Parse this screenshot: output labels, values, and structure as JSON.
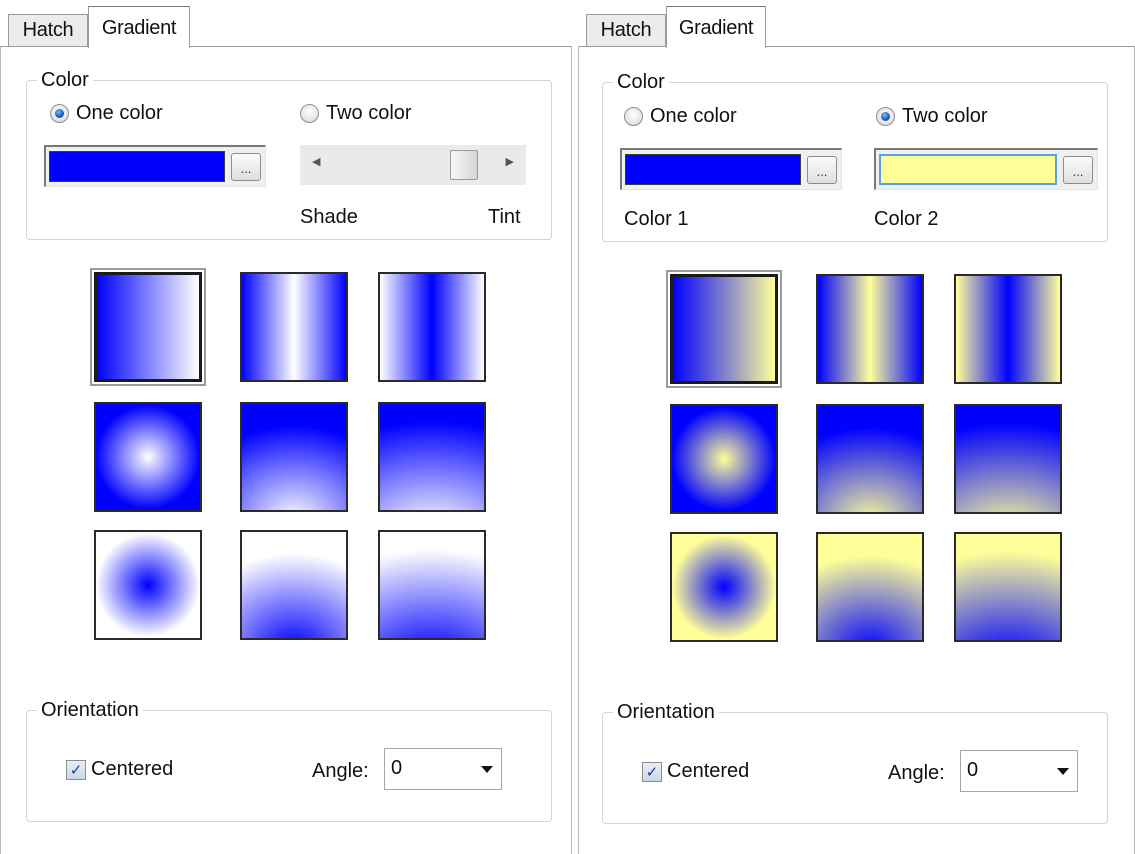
{
  "colors": {
    "blue": "#0000ff",
    "white": "#ffffff",
    "yellow": "#ffff99"
  },
  "left_panel": {
    "tabs": [
      {
        "label": "Hatch",
        "active": false
      },
      {
        "label": "Gradient",
        "active": true
      }
    ],
    "color_group": {
      "title": "Color",
      "one_color": {
        "label": "One color",
        "checked": true
      },
      "two_color": {
        "label": "Two color",
        "checked": false
      },
      "color1": "#0000ff",
      "browse_label": "...",
      "slider_labels": {
        "shade": "Shade",
        "tint": "Tint"
      },
      "slider_level": 0.85
    },
    "orientation_group": {
      "title": "Orientation",
      "centered": {
        "label": "Centered",
        "checked": true
      },
      "angle_label": "Angle:",
      "angle_value": "0"
    }
  },
  "right_panel": {
    "tabs": [
      {
        "label": "Hatch",
        "active": false
      },
      {
        "label": "Gradient",
        "active": true
      }
    ],
    "color_group": {
      "title": "Color",
      "one_color": {
        "label": "One color",
        "checked": false
      },
      "two_color": {
        "label": "Two color",
        "checked": true
      },
      "color1": "#0000ff",
      "color2": "#ffff99",
      "color1_label": "Color 1",
      "color2_label": "Color 2",
      "browse_label": "..."
    },
    "orientation_group": {
      "title": "Orientation",
      "centered": {
        "label": "Centered",
        "checked": true
      },
      "angle_label": "Angle:",
      "angle_value": "0"
    }
  },
  "gradient_patterns": [
    {
      "name": "linear",
      "selected": true
    },
    {
      "name": "cylinder",
      "selected": false
    },
    {
      "name": "invcylinder",
      "selected": false
    },
    {
      "name": "spherical",
      "selected": false
    },
    {
      "name": "hemispherical",
      "selected": false
    },
    {
      "name": "curved",
      "selected": false
    },
    {
      "name": "invspherical",
      "selected": false
    },
    {
      "name": "invhemispherical",
      "selected": false
    },
    {
      "name": "invcurved",
      "selected": false
    }
  ]
}
